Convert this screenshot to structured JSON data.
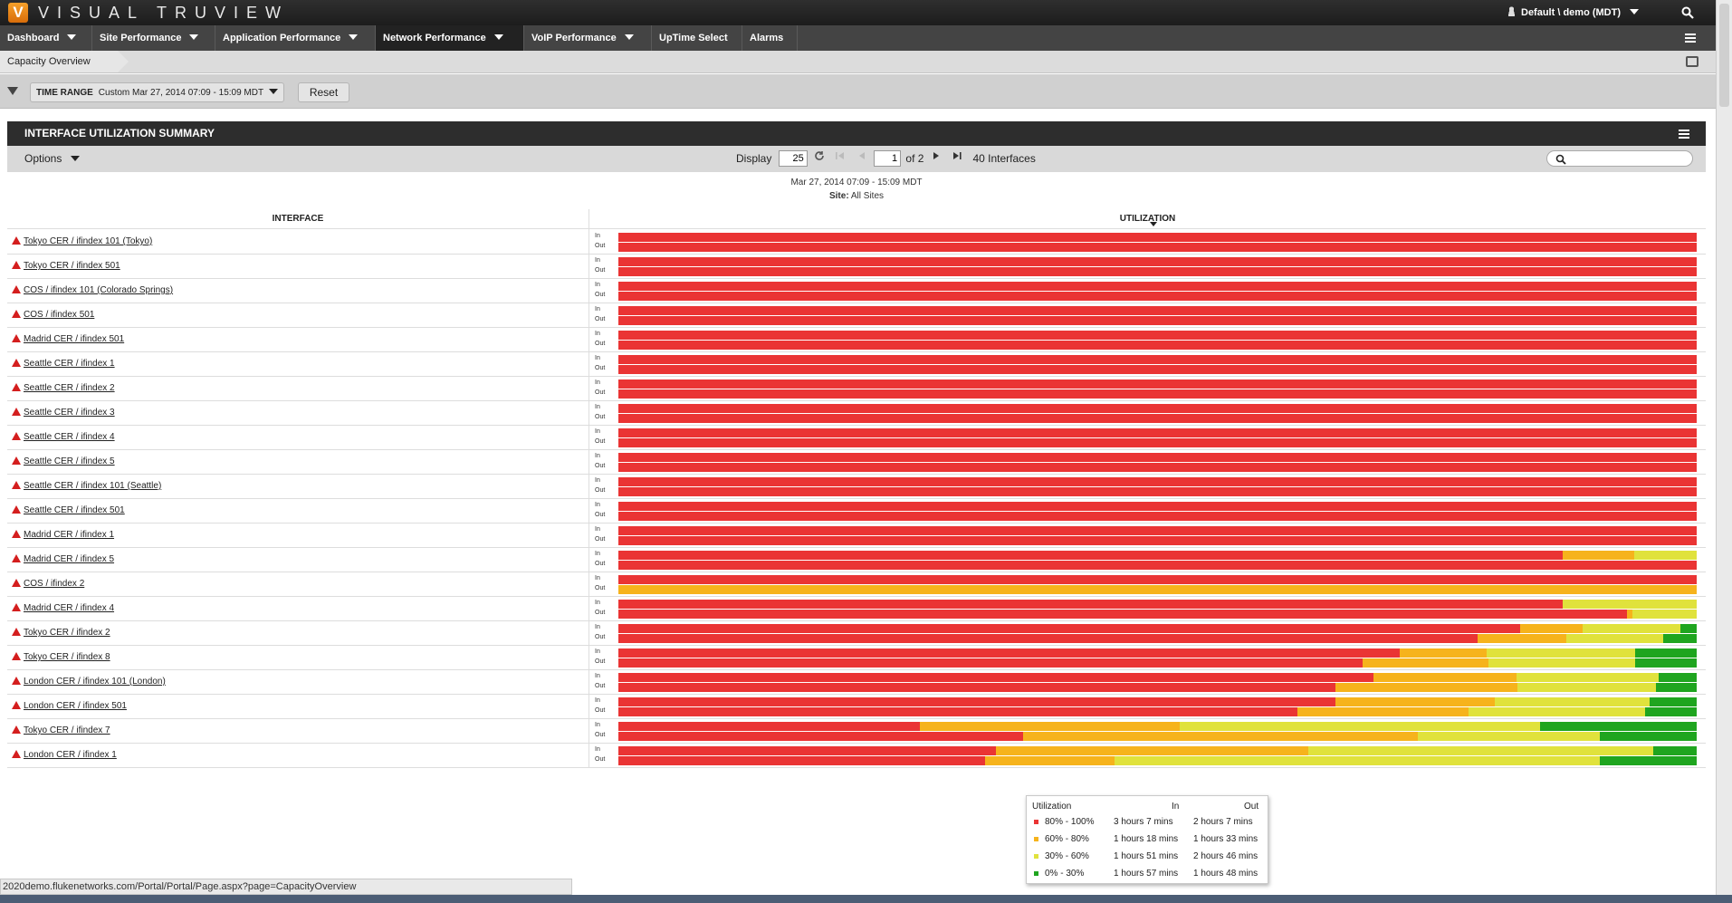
{
  "app": {
    "logo_letter": "V",
    "title": "VISUAL TRUVIEW",
    "user": "Default \\ demo (MDT)"
  },
  "nav": [
    {
      "label": "Dashboard",
      "dropdown": true,
      "active": false
    },
    {
      "label": "Site Performance",
      "dropdown": true,
      "active": false
    },
    {
      "label": "Application Performance",
      "dropdown": true,
      "active": false
    },
    {
      "label": "Network Performance",
      "dropdown": true,
      "active": true
    },
    {
      "label": "VoIP Performance",
      "dropdown": true,
      "active": false
    },
    {
      "label": "UpTime Select",
      "dropdown": false,
      "active": false
    },
    {
      "label": "Alarms",
      "dropdown": false,
      "active": false
    }
  ],
  "breadcrumb": "Capacity Overview",
  "filter": {
    "time_range_key": "TIME RANGE",
    "time_range_value": "Custom Mar 27, 2014 07:09 - 15:09 MDT",
    "reset_label": "Reset"
  },
  "panel": {
    "title": "INTERFACE UTILIZATION SUMMARY",
    "options_label": "Options",
    "display_label": "Display",
    "display_value": "25",
    "page_value": "1",
    "page_of": "of 2",
    "count_label": "40 Interfaces",
    "date_range": "Mar 27, 2014 07:09 - 15:09 MDT",
    "site_key": "Site:",
    "site_value": "All Sites",
    "col_interface": "INTERFACE",
    "col_utilization": "UTILIZATION",
    "in_label": "In",
    "out_label": "Out"
  },
  "colors": {
    "red": "#ea3434",
    "orange": "#f6b31c",
    "yellow": "#e0e23c",
    "green": "#1fa51f"
  },
  "rows": [
    {
      "name": "Tokyo CER / ifindex 101 (Tokyo)",
      "in": [
        100,
        0,
        0,
        0
      ],
      "out": [
        100,
        0,
        0,
        0
      ]
    },
    {
      "name": "Tokyo CER / ifindex 501",
      "in": [
        100,
        0,
        0,
        0
      ],
      "out": [
        100,
        0,
        0,
        0
      ]
    },
    {
      "name": "COS / ifindex 101 (Colorado Springs)",
      "in": [
        100,
        0,
        0,
        0
      ],
      "out": [
        100,
        0,
        0,
        0
      ]
    },
    {
      "name": "COS / ifindex 501",
      "in": [
        100,
        0,
        0,
        0
      ],
      "out": [
        100,
        0,
        0,
        0
      ]
    },
    {
      "name": "Madrid CER / ifindex 501",
      "in": [
        100,
        0,
        0,
        0
      ],
      "out": [
        100,
        0,
        0,
        0
      ]
    },
    {
      "name": "Seattle CER / ifindex 1",
      "in": [
        100,
        0,
        0,
        0
      ],
      "out": [
        100,
        0,
        0,
        0
      ]
    },
    {
      "name": "Seattle CER / ifindex 2",
      "in": [
        100,
        0,
        0,
        0
      ],
      "out": [
        100,
        0,
        0,
        0
      ]
    },
    {
      "name": "Seattle CER / ifindex 3",
      "in": [
        100,
        0,
        0,
        0
      ],
      "out": [
        100,
        0,
        0,
        0
      ]
    },
    {
      "name": "Seattle CER / ifindex 4",
      "in": [
        100,
        0,
        0,
        0
      ],
      "out": [
        100,
        0,
        0,
        0
      ]
    },
    {
      "name": "Seattle CER / ifindex 5",
      "in": [
        100,
        0,
        0,
        0
      ],
      "out": [
        100,
        0,
        0,
        0
      ]
    },
    {
      "name": "Seattle CER / ifindex 101 (Seattle)",
      "in": [
        100,
        0,
        0,
        0
      ],
      "out": [
        100,
        0,
        0,
        0
      ]
    },
    {
      "name": "Seattle CER / ifindex 501",
      "in": [
        100,
        0,
        0,
        0
      ],
      "out": [
        100,
        0,
        0,
        0
      ]
    },
    {
      "name": "Madrid CER / ifindex 1",
      "in": [
        100,
        0,
        0,
        0
      ],
      "out": [
        100,
        0,
        0,
        0
      ]
    },
    {
      "name": "Madrid CER / ifindex 5",
      "in": [
        87.6,
        6.6,
        5.8,
        0
      ],
      "out": [
        100,
        0,
        0,
        0
      ]
    },
    {
      "name": "COS / ifindex 2",
      "in": [
        100,
        0,
        0,
        0
      ],
      "out": [
        0,
        100,
        0,
        0
      ]
    },
    {
      "name": "Madrid CER / ifindex 4",
      "in": [
        87.6,
        0,
        12.4,
        0
      ],
      "out": [
        93.5,
        0.5,
        6,
        0
      ]
    },
    {
      "name": "Tokyo CER / ifindex 2",
      "in": [
        83.6,
        5.8,
        9.1,
        1.5
      ],
      "out": [
        79.7,
        8.2,
        9,
        3.1
      ]
    },
    {
      "name": "Tokyo CER / ifindex 8",
      "in": [
        72.5,
        8,
        13.8,
        5.7
      ],
      "out": [
        69,
        11.7,
        13.6,
        5.7
      ]
    },
    {
      "name": "London CER / ifindex 101 (London)",
      "in": [
        70,
        13.3,
        13.2,
        3.5
      ],
      "out": [
        66.5,
        16.9,
        12.8,
        3.8
      ]
    },
    {
      "name": "London CER / ifindex 501",
      "in": [
        66.5,
        14.8,
        14.3,
        4.4
      ],
      "out": [
        63,
        15.8,
        16.4,
        4.8
      ]
    },
    {
      "name": "Tokyo CER / ifindex 7",
      "in": [
        28,
        24.1,
        33.4,
        14.5
      ],
      "out": [
        37.5,
        36.6,
        16.9,
        9.0
      ]
    },
    {
      "name": "London CER / ifindex 1",
      "in": [
        35,
        29,
        32,
        4
      ],
      "out": [
        34,
        12,
        45,
        9
      ]
    }
  ],
  "tooltip": {
    "title": "Utilization",
    "col_in": "In",
    "col_out": "Out",
    "rows": [
      {
        "range": "80% - 100%",
        "in": "3 hours 7 mins",
        "out": "2 hours 7 mins",
        "color": "#ea3434"
      },
      {
        "range": "60% - 80%",
        "in": "1 hours 18 mins",
        "out": "1 hours 33 mins",
        "color": "#f6b31c"
      },
      {
        "range": "30% - 60%",
        "in": "1 hours 51 mins",
        "out": "2 hours 46 mins",
        "color": "#e0e23c"
      },
      {
        "range": "0% - 30%",
        "in": "1 hours 57 mins",
        "out": "1 hours 48 mins",
        "color": "#1fa51f"
      }
    ]
  },
  "status_url": "2020demo.flukenetworks.com/Portal/Portal/Page.aspx?page=CapacityOverview"
}
